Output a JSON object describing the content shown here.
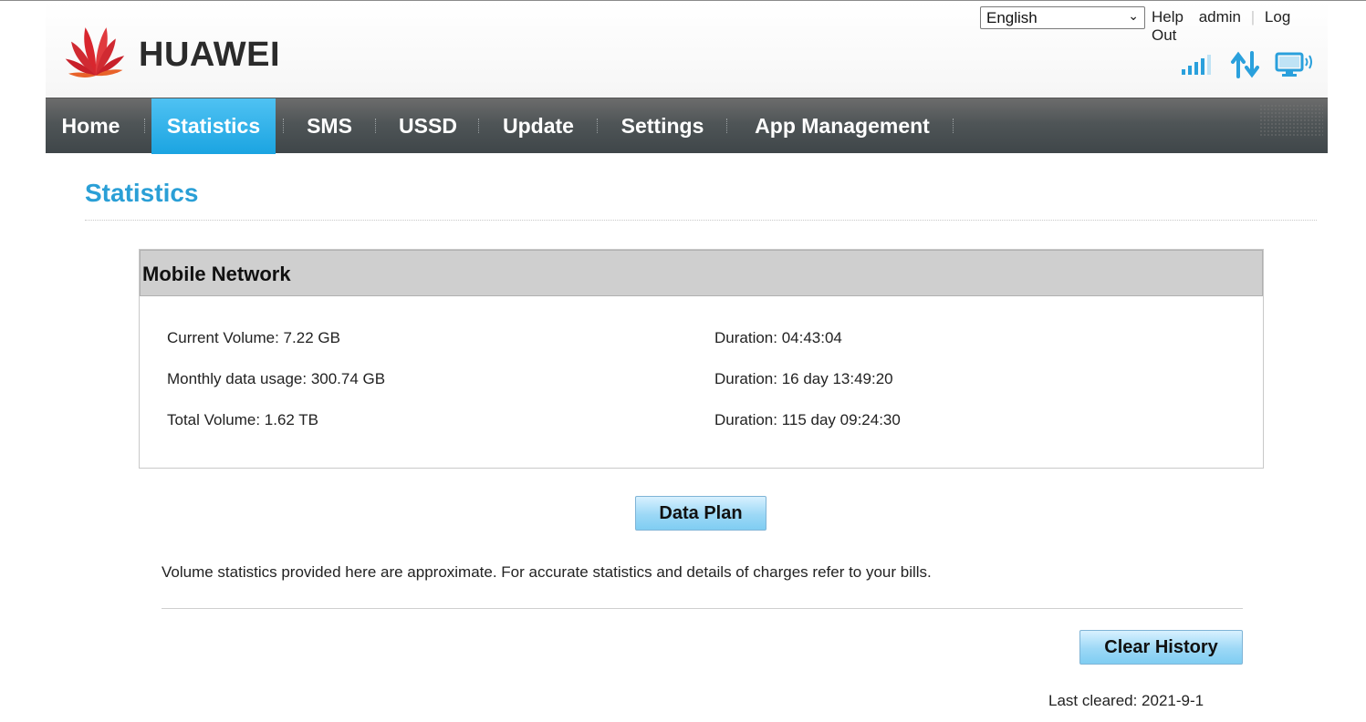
{
  "brand": {
    "name": "HUAWEI"
  },
  "header": {
    "language": "English",
    "links": {
      "help": "Help",
      "user": "admin",
      "logout": "Log Out"
    },
    "icons": [
      "signal-strength-icon",
      "data-transfer-icon",
      "connected-device-icon"
    ],
    "accent_color": "#1ba4e1"
  },
  "nav": {
    "items": [
      "Home",
      "Statistics",
      "SMS",
      "USSD",
      "Update",
      "Settings",
      "App Management"
    ],
    "active": "Statistics"
  },
  "page": {
    "title": "Statistics"
  },
  "mobile_network": {
    "title": "Mobile Network",
    "rows": [
      {
        "left": "Current Volume: 7.22 GB",
        "right": "Duration: 04:43:04"
      },
      {
        "left": "Monthly data usage: 300.74 GB",
        "right": "Duration: 16 day 13:49:20"
      },
      {
        "left": "Total Volume: 1.62 TB",
        "right": "Duration: 115 day 09:24:30"
      }
    ]
  },
  "buttons": {
    "data_plan": "Data Plan",
    "clear_history": "Clear History"
  },
  "note": "Volume statistics provided here are approximate. For accurate statistics and details of charges refer to your bills.",
  "last_cleared": "Last cleared: 2021-9-1"
}
